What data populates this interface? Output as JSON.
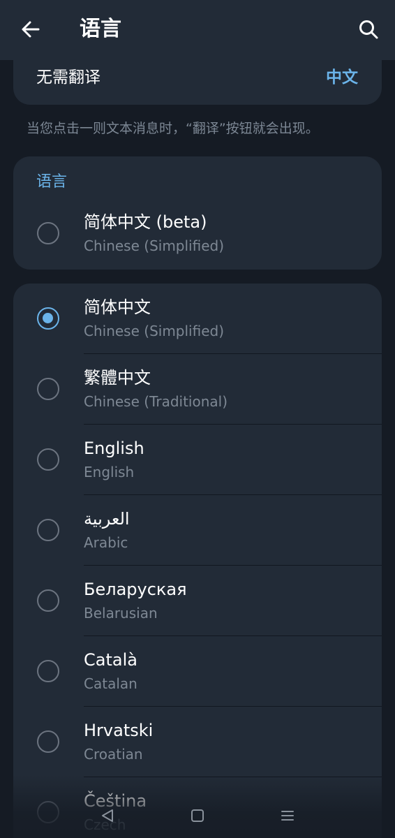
{
  "header": {
    "title": "语言",
    "back_icon": "arrow-left-icon",
    "search_icon": "search-icon"
  },
  "do_not_translate": {
    "label": "无需翻译",
    "value": "中文"
  },
  "hint": "当您点击一则文本消息时，“翻译”按钮就会出现。",
  "language_section": {
    "title": "语言",
    "items": [
      {
        "title": "简体中文 (beta)",
        "subtitle": "Chinese (Simplified)",
        "selected": false
      }
    ]
  },
  "languages": [
    {
      "title": "简体中文",
      "subtitle": "Chinese (Simplified)",
      "selected": true
    },
    {
      "title": "繁體中文",
      "subtitle": "Chinese (Traditional)",
      "selected": false
    },
    {
      "title": "English",
      "subtitle": "English",
      "selected": false
    },
    {
      "title": "العربية",
      "subtitle": "Arabic",
      "selected": false
    },
    {
      "title": "Беларуская",
      "subtitle": "Belarusian",
      "selected": false
    },
    {
      "title": "Català",
      "subtitle": "Catalan",
      "selected": false
    },
    {
      "title": "Hrvatski",
      "subtitle": "Croatian",
      "selected": false
    },
    {
      "title": "Čeština",
      "subtitle": "Czech",
      "selected": false
    }
  ],
  "navbar": {
    "back_icon": "triangle-back-icon",
    "home_icon": "square-home-icon",
    "recents_icon": "menu-lines-icon"
  },
  "colors": {
    "background": "#151b24",
    "card": "#222b37",
    "accent": "#6bb4ea",
    "muted_text": "#7e8894"
  }
}
